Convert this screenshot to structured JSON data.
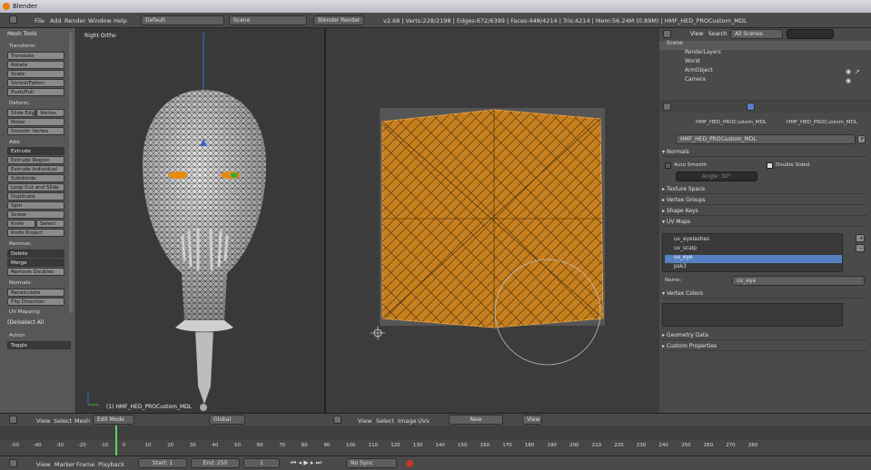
{
  "window": {
    "title": "Blender"
  },
  "topbar": {
    "menus": [
      "File",
      "Add",
      "Render",
      "Window",
      "Help"
    ],
    "layout": "Default",
    "scene": "Scene",
    "engine": "Blender Render",
    "stats": "v2.68 | Verts:228/2198 | Edges:672/6399 | Faces:448/4214 | Tris:4214 | Mem:56.24M (0.89M) | HMF_HED_PROCustom_MDL"
  },
  "toolshelf": {
    "title": "Mesh Tools",
    "transform": "Transform:",
    "transform_items": [
      "Translate",
      "Rotate",
      "Scale",
      "Shrink/Fatten",
      "Push/Pull"
    ],
    "deform": "Deform:",
    "slide_edge": "Slide Edge",
    "vertex": "Vertex",
    "noise": "Noise",
    "smooth_vertex": "Smooth Vertex",
    "add": "Add:",
    "extrude": "Extrude",
    "add_items": [
      "Extrude Region",
      "Extrude Individual",
      "Subdivide",
      "Loop Cut and Slide",
      "Duplicate",
      "Spin",
      "Screw"
    ],
    "knife": "Knife",
    "select": "Select",
    "knife_project": "Knife Project",
    "remove": "Remove:",
    "delete": "Delete",
    "merge": "Merge",
    "remove_doubles": "Remove Doubles",
    "normals": "Normals:",
    "recalculate": "Recalculate",
    "flip_direction": "Flip Direction",
    "uv_mapping": "UV Mapping",
    "deselect_all": "(De)select All",
    "action": "Action",
    "toggle": "Toggle"
  },
  "viewport3d": {
    "view_label": "Right Ortho",
    "object_label": "(1) HMF_HED_PROCustom_MDL"
  },
  "outliner": {
    "view": "View",
    "search": "Search",
    "filter": "All Scenes",
    "rows": [
      "Scene",
      "RenderLayers",
      "World",
      "ArmObject",
      "Camera"
    ]
  },
  "properties": {
    "breadcrumb_a": "HMF_HED_PROCustom_MDL",
    "breadcrumb_b": "HMF_HED_PROCustom_MDL",
    "mesh_name": "HMF_HED_PROCustom_MDL",
    "mesh_letter": "F",
    "normals": "Normals",
    "auto_smooth": "Auto Smooth",
    "double_sided": "Double Sided",
    "angle": "Angle: 30°",
    "texture_space": "Texture Space",
    "vertex_groups": "Vertex Groups",
    "shape_keys": "Shape Keys",
    "uv_maps": "UV Maps",
    "uv_list": [
      "uv_eyelashes",
      "uv_scalp",
      "uv_eye",
      "psk3"
    ],
    "name_label": "Name:",
    "name_value": "uv_eye",
    "vertex_colors": "Vertex Colors",
    "geometry_data": "Geometry Data",
    "custom_properties": "Custom Properties"
  },
  "header3d": {
    "menus": [
      "View",
      "Select",
      "Mesh"
    ],
    "mode": "Edit Mode",
    "orientation": "Global"
  },
  "headeruv": {
    "menus": [
      "View",
      "Select",
      "Image",
      "UVs"
    ],
    "new": "New",
    "view": "View"
  },
  "timeline": {
    "ticks": [
      "-50",
      "-40",
      "-30",
      "-20",
      "-10",
      "0",
      "10",
      "20",
      "30",
      "40",
      "50",
      "60",
      "70",
      "80",
      "90",
      "100",
      "110",
      "120",
      "130",
      "140",
      "150",
      "160",
      "170",
      "180",
      "190",
      "200",
      "210",
      "220",
      "230",
      "240",
      "250",
      "260",
      "270",
      "280"
    ]
  },
  "bottombar": {
    "menus": [
      "View",
      "Marker",
      "Frame",
      "Playback"
    ],
    "start": "Start: 1",
    "end": "End: 250",
    "frame": "1",
    "sync": "No Sync"
  },
  "colors": {
    "accent": "#e87d0d",
    "uv_fill": "#c8801e",
    "selection": "#5680c2"
  }
}
